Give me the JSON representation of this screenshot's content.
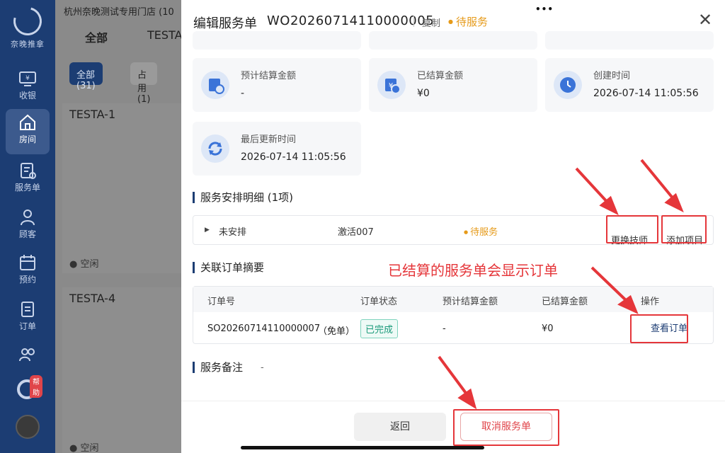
{
  "sidebar": {
    "brand": "奈晚推拿",
    "items": [
      {
        "label": "收银",
        "icon": "cashier-icon"
      },
      {
        "label": "房间",
        "icon": "home-icon"
      },
      {
        "label": "服务单",
        "icon": "service-order-icon"
      },
      {
        "label": "顾客",
        "icon": "customer-icon"
      },
      {
        "label": "预约",
        "icon": "calendar-icon"
      },
      {
        "label": "订单",
        "icon": "order-icon"
      },
      {
        "label": "",
        "icon": "staff-icon"
      }
    ],
    "active": "房间",
    "help_badge": "帮助"
  },
  "background": {
    "store_name": "杭州奈晚测试专用门店   (10",
    "tabs": [
      "全部",
      "TESTA"
    ],
    "filters": [
      "全部(31)",
      "占用(1)"
    ],
    "rooms": [
      {
        "name": "TESTA-1",
        "status": "● 空闲"
      },
      {
        "name": "TESTA-4",
        "status": "● 空闲"
      }
    ]
  },
  "drawer": {
    "title": "编辑服务单",
    "order_no": "WO20260714110000005",
    "copy_label": "复制",
    "status": "待服务",
    "cards": [
      {
        "label": "预计结算金额",
        "value": "-",
        "icon": "estimate-icon"
      },
      {
        "label": "已结算金额",
        "value": "¥0",
        "icon": "settled-icon"
      },
      {
        "label": "创建时间",
        "value": "2026-07-14 11:05:56",
        "icon": "clock-icon"
      },
      {
        "label": "最后更新时间",
        "value": "2026-07-14 11:05:56",
        "icon": "refresh-icon"
      }
    ],
    "arrangement": {
      "title": "服务安排明细 (1项)",
      "row": {
        "assign": "未安排",
        "tech": "激活007",
        "status": "待服务"
      },
      "change_tech": "更换技师",
      "add_item": "添加项目"
    },
    "orders": {
      "title": "关联订单摘要",
      "columns": [
        "订单号",
        "订单状态",
        "预计结算金额",
        "已结算金额",
        "操作"
      ],
      "rows": [
        {
          "order_no": "SO20260714110000007",
          "tag": "（免单）",
          "status": "已完成",
          "estimate": "-",
          "settled": "¥0",
          "action": "查看订单"
        }
      ]
    },
    "remark": {
      "title": "服务备注",
      "value": "-"
    },
    "footer": {
      "back": "返回",
      "cancel": "取消服务单"
    }
  },
  "annotation": {
    "text": "已结算的服务单会显示订单",
    "color": "#e5363a"
  },
  "colors": {
    "brand": "#1c3d73",
    "pending": "#e69a19",
    "danger": "#e0454a",
    "success": "#1a9a7a"
  }
}
